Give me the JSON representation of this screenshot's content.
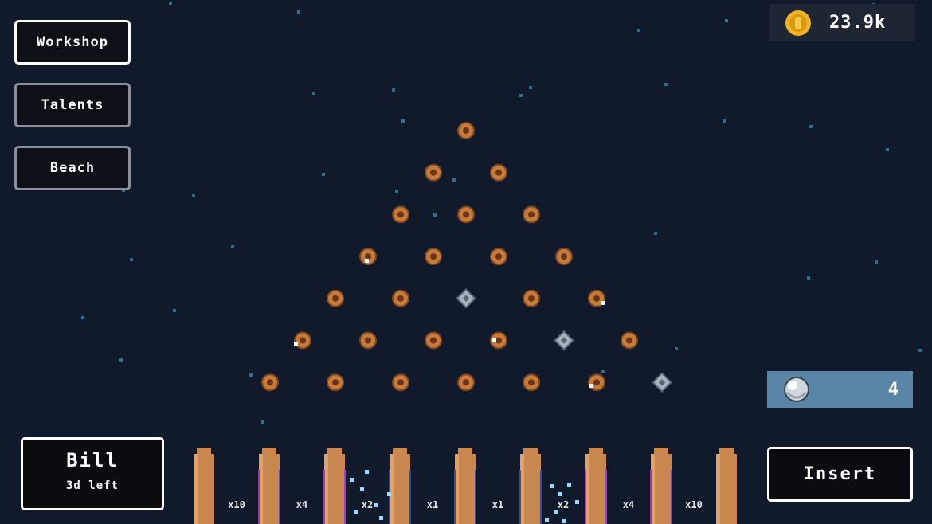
{
  "menu": {
    "workshop_label": "Workshop",
    "talents_label": "Talents",
    "beach_label": "Beach"
  },
  "currency": {
    "coins": "23.9k",
    "icon": "gold-coin-icon",
    "color": "#f0b323"
  },
  "balls": {
    "count": "4",
    "icon": "silver-ball-icon"
  },
  "bill": {
    "name": "Bill",
    "time_left": "3d left"
  },
  "insert_label": "Insert",
  "multipliers": [
    "x10",
    "x4",
    "x2",
    "x1",
    "x1",
    "x2",
    "x4",
    "x10"
  ],
  "board": {
    "rows": [
      [
        "copper"
      ],
      [
        "copper",
        "copper"
      ],
      [
        "copper",
        "copper",
        "copper"
      ],
      [
        "copper",
        "copper",
        "copper",
        "copper"
      ],
      [
        "copper",
        "copper",
        "silver",
        "copper",
        "copper"
      ],
      [
        "copper",
        "copper",
        "copper",
        "copper",
        "silver",
        "copper"
      ],
      [
        "copper",
        "copper",
        "copper",
        "copper",
        "copper",
        "copper",
        "silver"
      ]
    ],
    "peg_colors": {
      "copper": "#c77b3a",
      "silver": "#a9b4bf"
    }
  },
  "colors": {
    "background": "#111a2a",
    "slot_post": "#c7874f",
    "ball_panel": "#5985a6"
  }
}
